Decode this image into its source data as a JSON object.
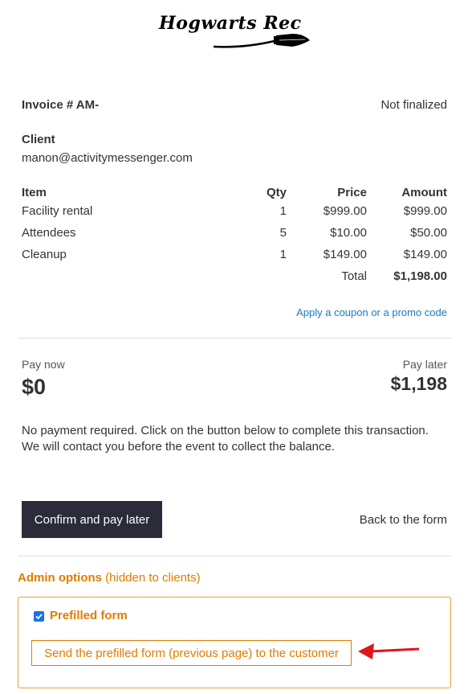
{
  "logo": {
    "text": "Hogwarts Rec"
  },
  "invoice": {
    "number_label": "Invoice # AM-",
    "status": "Not finalized"
  },
  "client": {
    "label": "Client",
    "email": "manon@activitymessenger.com"
  },
  "table": {
    "headers": {
      "item": "Item",
      "qty": "Qty",
      "price": "Price",
      "amount": "Amount"
    },
    "rows": [
      {
        "item": "Facility rental",
        "qty": "1",
        "price": "$999.00",
        "amount": "$999.00"
      },
      {
        "item": "Attendees",
        "qty": "5",
        "price": "$10.00",
        "amount": "$50.00"
      },
      {
        "item": "Cleanup",
        "qty": "1",
        "price": "$149.00",
        "amount": "$149.00"
      }
    ],
    "total_label": "Total",
    "total_value": "$1,198.00"
  },
  "coupon_link": "Apply a coupon or a promo code",
  "payment": {
    "pay_now_label": "Pay now",
    "pay_now_value": "$0",
    "pay_later_label": "Pay later",
    "pay_later_value": "$1,198"
  },
  "message": {
    "line1": "No payment required. Click on the button below to complete this transaction.",
    "line2": "We will contact you before the event to collect the balance."
  },
  "actions": {
    "confirm_label": "Confirm and pay later",
    "back_label": "Back to the form"
  },
  "admin": {
    "title": "Admin options",
    "subtitle": "(hidden to clients)",
    "prefilled_label": "Prefilled form",
    "prefilled_checked": true,
    "send_label": "Send the prefilled form (previous page) to the customer"
  },
  "colors": {
    "accent_orange": "#e07b00",
    "link_blue": "#1a7bbf",
    "button_dark": "#2b2b3a",
    "arrow_red": "#e0141e"
  },
  "icons": [
    "broomstick-icon",
    "checkbox-icon",
    "arrow-left-icon"
  ]
}
